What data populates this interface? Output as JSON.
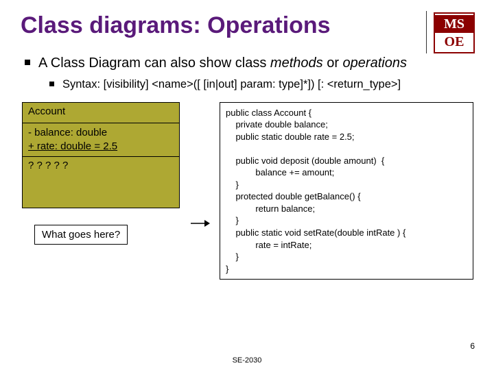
{
  "title": "Class diagrams: Operations",
  "logo": {
    "top": "MS",
    "bottom": "OE"
  },
  "bullet_main_prefix": "A Class Diagram can also show class ",
  "bullet_main_italic1": "methods",
  "bullet_main_mid": " or ",
  "bullet_main_italic2": "operations",
  "bullet_sub": "Syntax: [visibility] <name>([ [in|out] param: type]*]) [: <return_type>]",
  "uml": {
    "class_name": "Account",
    "attr1": "- balance: double",
    "attr2": "+ rate: double = 2.5",
    "ops_placeholder": "? ? ? ? ?"
  },
  "what_goes": "What goes here?",
  "code": "public class Account {\n    private double balance;\n    public static double rate = 2.5;\n\n    public void deposit (double amount)  {\n            balance += amount;\n    }\n    protected double getBalance() {\n            return balance;\n    }\n    public static void setRate(double intRate ) {\n            rate = intRate;\n    }\n}",
  "footer": "SE-2030",
  "page": "6"
}
